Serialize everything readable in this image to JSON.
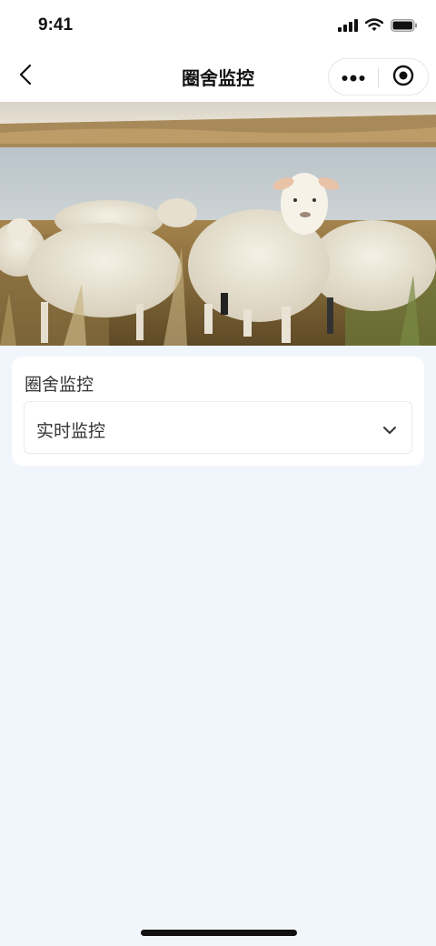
{
  "status_bar": {
    "time": "9:41",
    "icons": [
      "signal-icon",
      "wifi-icon",
      "battery-icon"
    ]
  },
  "nav_bar": {
    "title": "圈舍监控",
    "back_icon": "chevron-left-icon",
    "more_icon": "more-dots-icon",
    "close_icon": "target-circle-icon"
  },
  "hero": {
    "image": "photo of white sheep standing in tall grass by a lake"
  },
  "monitor_card": {
    "title": "圈舍监控",
    "select": {
      "value": "实时监控",
      "icon": "chevron-down-icon"
    }
  },
  "colors": {
    "page_background": "#f1f6fd",
    "card_background": "#ffffff",
    "text": "#333333",
    "title_text": "#111111"
  }
}
